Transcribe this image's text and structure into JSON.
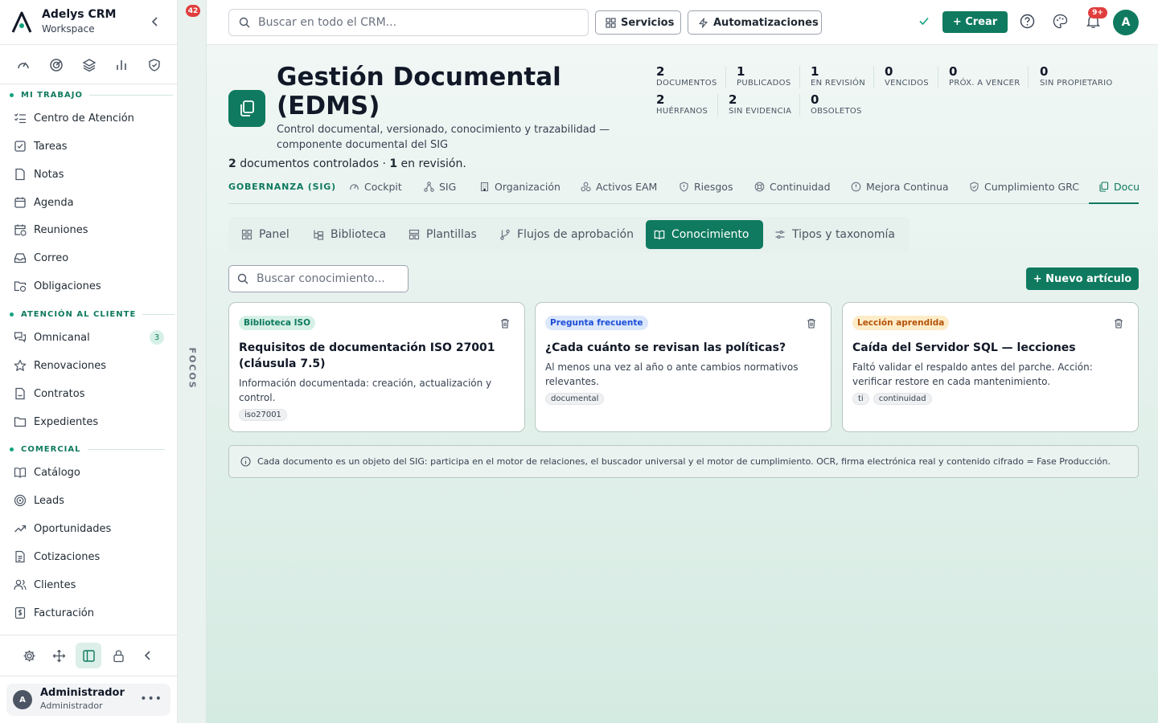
{
  "brand": {
    "name": "Adelys CRM",
    "sub": "Workspace"
  },
  "sidebar": {
    "sections": [
      {
        "label": "MI TRABAJO",
        "items": [
          {
            "label": "Centro de Atención",
            "icon": "list-checks-icon"
          },
          {
            "label": "Tareas",
            "icon": "checkbox-icon"
          },
          {
            "label": "Notas",
            "icon": "note-icon"
          },
          {
            "label": "Agenda",
            "icon": "calendar-icon"
          },
          {
            "label": "Reuniones",
            "icon": "calendar-clock-icon"
          },
          {
            "label": "Correo",
            "icon": "inbox-icon"
          },
          {
            "label": "Obligaciones",
            "icon": "folder-clock-icon"
          }
        ]
      },
      {
        "label": "ATENCIÓN AL CLIENTE",
        "items": [
          {
            "label": "Omnicanal",
            "icon": "messages-icon",
            "badge": "3"
          },
          {
            "label": "Renovaciones",
            "icon": "star-icon"
          },
          {
            "label": "Contratos",
            "icon": "contract-icon"
          },
          {
            "label": "Expedientes",
            "icon": "folder-icon"
          }
        ]
      },
      {
        "label": "COMERCIAL",
        "items": [
          {
            "label": "Catálogo",
            "icon": "book-open-icon"
          },
          {
            "label": "Leads",
            "icon": "target-icon"
          },
          {
            "label": "Oportunidades",
            "icon": "trending-up-icon"
          },
          {
            "label": "Cotizaciones",
            "icon": "file-text-icon"
          },
          {
            "label": "Clientes",
            "icon": "users-icon"
          },
          {
            "label": "Facturación",
            "icon": "invoice-icon"
          }
        ]
      }
    ]
  },
  "user": {
    "initial": "A",
    "name": "Administrador",
    "role": "Administrador"
  },
  "rail": {
    "badge": "42",
    "label": "FOCOS"
  },
  "topbar": {
    "search_placeholder": "Buscar en todo el CRM...",
    "servicios": "Servicios",
    "automatizaciones": "Automatizaciones",
    "create": "+ Crear",
    "notif_badge": "9+",
    "avatar": "A"
  },
  "page": {
    "title": "Gestión Documental (EDMS)",
    "description": "Control documental, versionado, conocimiento y trazabilidad — componente documental del SIG",
    "summary": {
      "count1": "2",
      "text1": " documentos controlados · ",
      "count2": "1",
      "text2": " en revisión."
    }
  },
  "stats": [
    {
      "value": "2",
      "label": "DOCUMENTOS"
    },
    {
      "value": "1",
      "label": "PUBLICADOS"
    },
    {
      "value": "1",
      "label": "EN REVISIÓN"
    },
    {
      "value": "0",
      "label": "VENCIDOS"
    },
    {
      "value": "0",
      "label": "PRÓX. A VENCER"
    },
    {
      "value": "0",
      "label": "SIN PROPIETARIO"
    },
    {
      "value": "2",
      "label": "HUÉRFANOS"
    },
    {
      "value": "2",
      "label": "SIN EVIDENCIA"
    },
    {
      "value": "0",
      "label": "OBSOLETOS"
    }
  ],
  "module_tabs": {
    "label": "GOBERNANZA (SIG)",
    "tabs": [
      "Cockpit",
      "SIG",
      "Organización",
      "Activos EAM",
      "Riesgos",
      "Continuidad",
      "Mejora Continua",
      "Cumplimiento GRC",
      "Docu"
    ]
  },
  "sub_tabs": [
    "Panel",
    "Biblioteca",
    "Plantillas",
    "Flujos de aprobación",
    "Conocimiento",
    "Tipos y taxonomía"
  ],
  "knowledge": {
    "search_placeholder": "Buscar conocimiento...",
    "new_button": "+ Nuevo artículo",
    "cards": [
      {
        "badge": "Biblioteca ISO",
        "badge_color": "#0f7a5f",
        "badge_bg": "#d6f0e6",
        "title": "Requisitos de documentación ISO 27001 (cláusula 7.5)",
        "text": "Información documentada: creación, actualización y control.",
        "tags": [
          "iso27001"
        ]
      },
      {
        "badge": "Pregunta frecuente",
        "badge_color": "#1d4ed8",
        "badge_bg": "#dbe7fb",
        "title": "¿Cada cuánto se revisan las políticas?",
        "text": "Al menos una vez al año o ante cambios normativos relevantes.",
        "tags": [
          "documental"
        ]
      },
      {
        "badge": "Lección aprendida",
        "badge_color": "#b45309",
        "badge_bg": "#fdecc8",
        "title": "Caída del Servidor SQL — lecciones",
        "text": "Faltó validar el respaldo antes del parche. Acción: verificar restore en cada mantenimiento.",
        "tags": [
          "ti",
          "continuidad"
        ]
      }
    ]
  },
  "info": "Cada documento es un objeto del SIG: participa en el motor de relaciones, el buscador universal y el motor de cumplimiento. OCR, firma electrónica real y contenido cifrado = Fase Producción.",
  "colors": {
    "accent": "#0f7a5f",
    "danger": "#e03e3e"
  }
}
